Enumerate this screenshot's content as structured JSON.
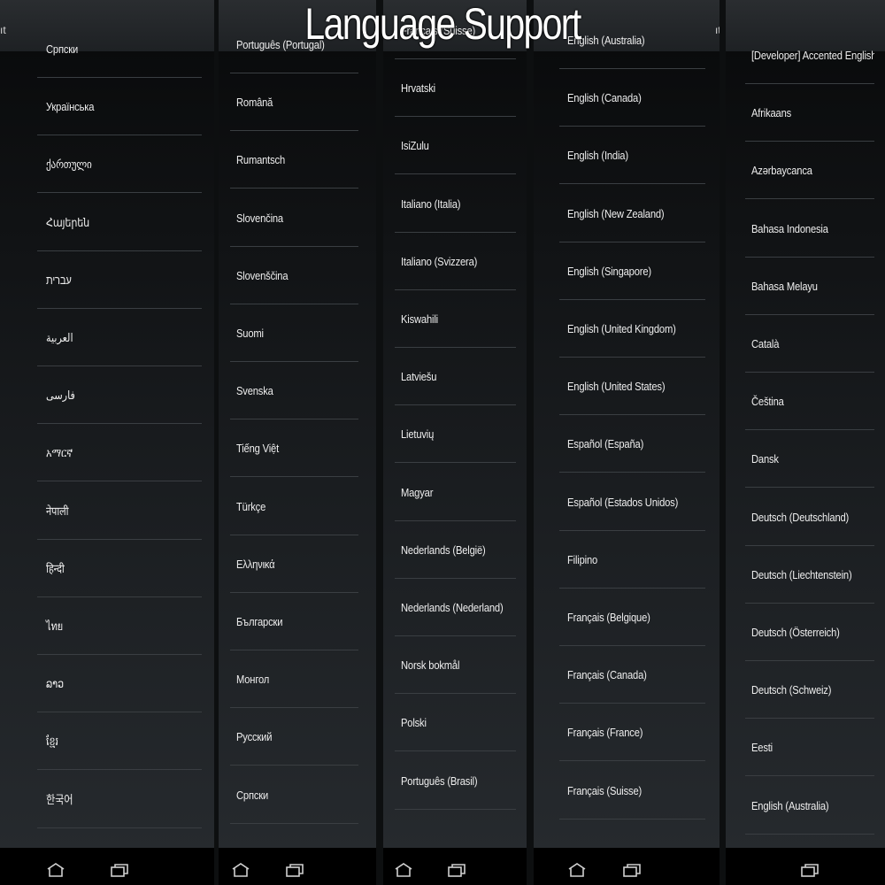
{
  "title": "Language Support",
  "colors": {
    "background": "#0d0f10",
    "text": "#eeeeee",
    "divider": "#3a3e42",
    "navbar": "#000000"
  },
  "panels": [
    {
      "crumb": "ıt",
      "languages": [
        "Српски",
        "Українська",
        "ქართული",
        "Հայերեն",
        "עברית",
        "العربية",
        "فارسی",
        "አማርኛ",
        "नेपाली",
        "हिन्दी",
        "ไทย",
        "ລາວ",
        "ខ្មែរ",
        "한국어"
      ]
    },
    {
      "crumb": "",
      "languages": [
        "Português (Portugal)",
        "Română",
        "Rumantsch",
        "Slovenčina",
        "Slovenščina",
        "Suomi",
        "Svenska",
        "Tiếng Việt",
        "Türkçe",
        "Ελληνικά",
        "Български",
        "Монгол",
        "Русский",
        "Српски"
      ]
    },
    {
      "crumb": "ıt",
      "languages": [
        "Français (Suisse)",
        "Hrvatski",
        "IsiZulu",
        "Italiano (Italia)",
        "Italiano (Svizzera)",
        "Kiswahili",
        "Latviešu",
        "Lietuvių",
        "Magyar",
        "Nederlands (België)",
        "Nederlands (Nederland)",
        "Norsk bokmål",
        "Polski",
        "Português (Brasil)"
      ]
    },
    {
      "crumb": "ıt",
      "languages": [
        "English (Australia)",
        "English (Canada)",
        "English (India)",
        "English (New Zealand)",
        "English (Singapore)",
        "English (United Kingdom)",
        "English (United States)",
        "Español (España)",
        "Español (Estados Unidos)",
        "Filipino",
        "Français (Belgique)",
        "Français (Canada)",
        "Français (France)",
        "Français (Suisse)"
      ]
    },
    {
      "crumb": "",
      "languages": [
        "[Developer] Accented English",
        "Afrikaans",
        "Azərbaycanca",
        "Bahasa Indonesia",
        "Bahasa Melayu",
        "Català",
        "Čeština",
        "Dansk",
        "Deutsch (Deutschland)",
        "Deutsch (Liechtenstein)",
        "Deutsch (Österreich)",
        "Deutsch (Schweiz)",
        "Eesti",
        "English (Australia)"
      ]
    }
  ],
  "navbar": {
    "buttons": [
      "home-icon",
      "recent-apps-icon"
    ]
  }
}
